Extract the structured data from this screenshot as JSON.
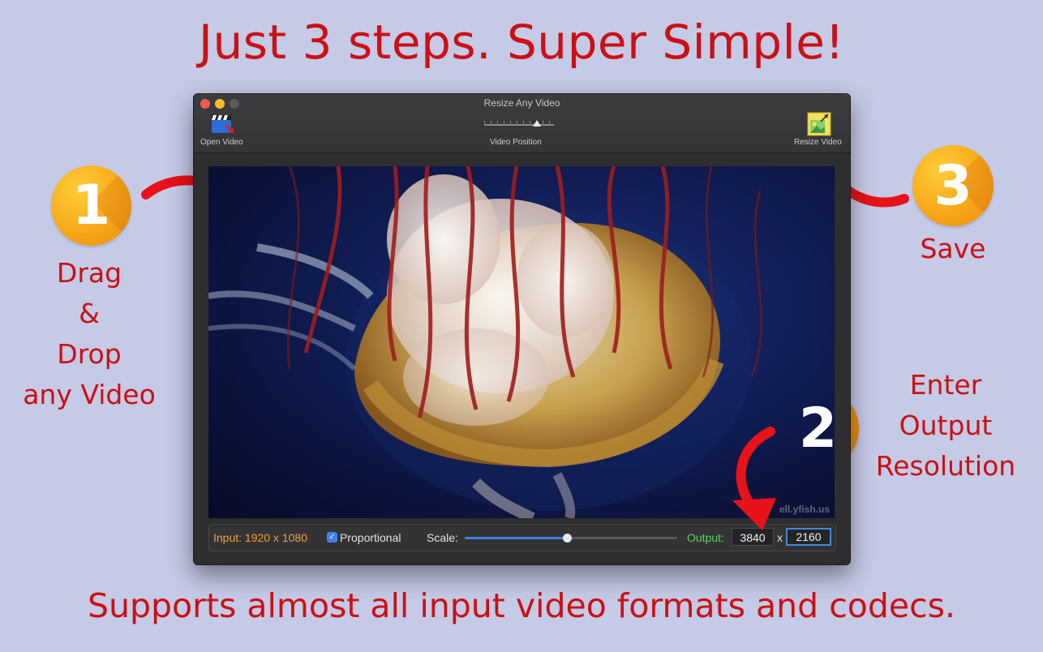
{
  "headline": "Just 3 steps. Super Simple!",
  "footer": "Supports almost all input video formats and codecs.",
  "steps": [
    {
      "number": "1",
      "lines": [
        "Drag",
        "&",
        "Drop",
        "any Video"
      ]
    },
    {
      "number": "2",
      "lines": [
        "Enter",
        "Output",
        "Resolution"
      ]
    },
    {
      "number": "3",
      "lines": [
        "Save"
      ]
    }
  ],
  "window": {
    "title": "Resize Any Video",
    "toolbar": {
      "open_label": "Open Video",
      "position_label": "Video Position",
      "resize_label": "Resize Video",
      "position_value": 0.75
    },
    "video": {
      "watermark": "ell.yfish.us"
    },
    "bottom": {
      "input_text": "Input: 1920 x 1080",
      "proportional_label": "Proportional",
      "proportional_checked": true,
      "scale_label": "Scale:",
      "scale_value": 0.48,
      "output_label": "Output:",
      "width": "3840",
      "x": "x",
      "height": "2160"
    }
  },
  "colors": {
    "accent_text": "#cc0f14",
    "background": "#c5cae6",
    "badge": "#f7a81a",
    "input_label": "#f0a040",
    "output_label": "#5fd05f"
  }
}
